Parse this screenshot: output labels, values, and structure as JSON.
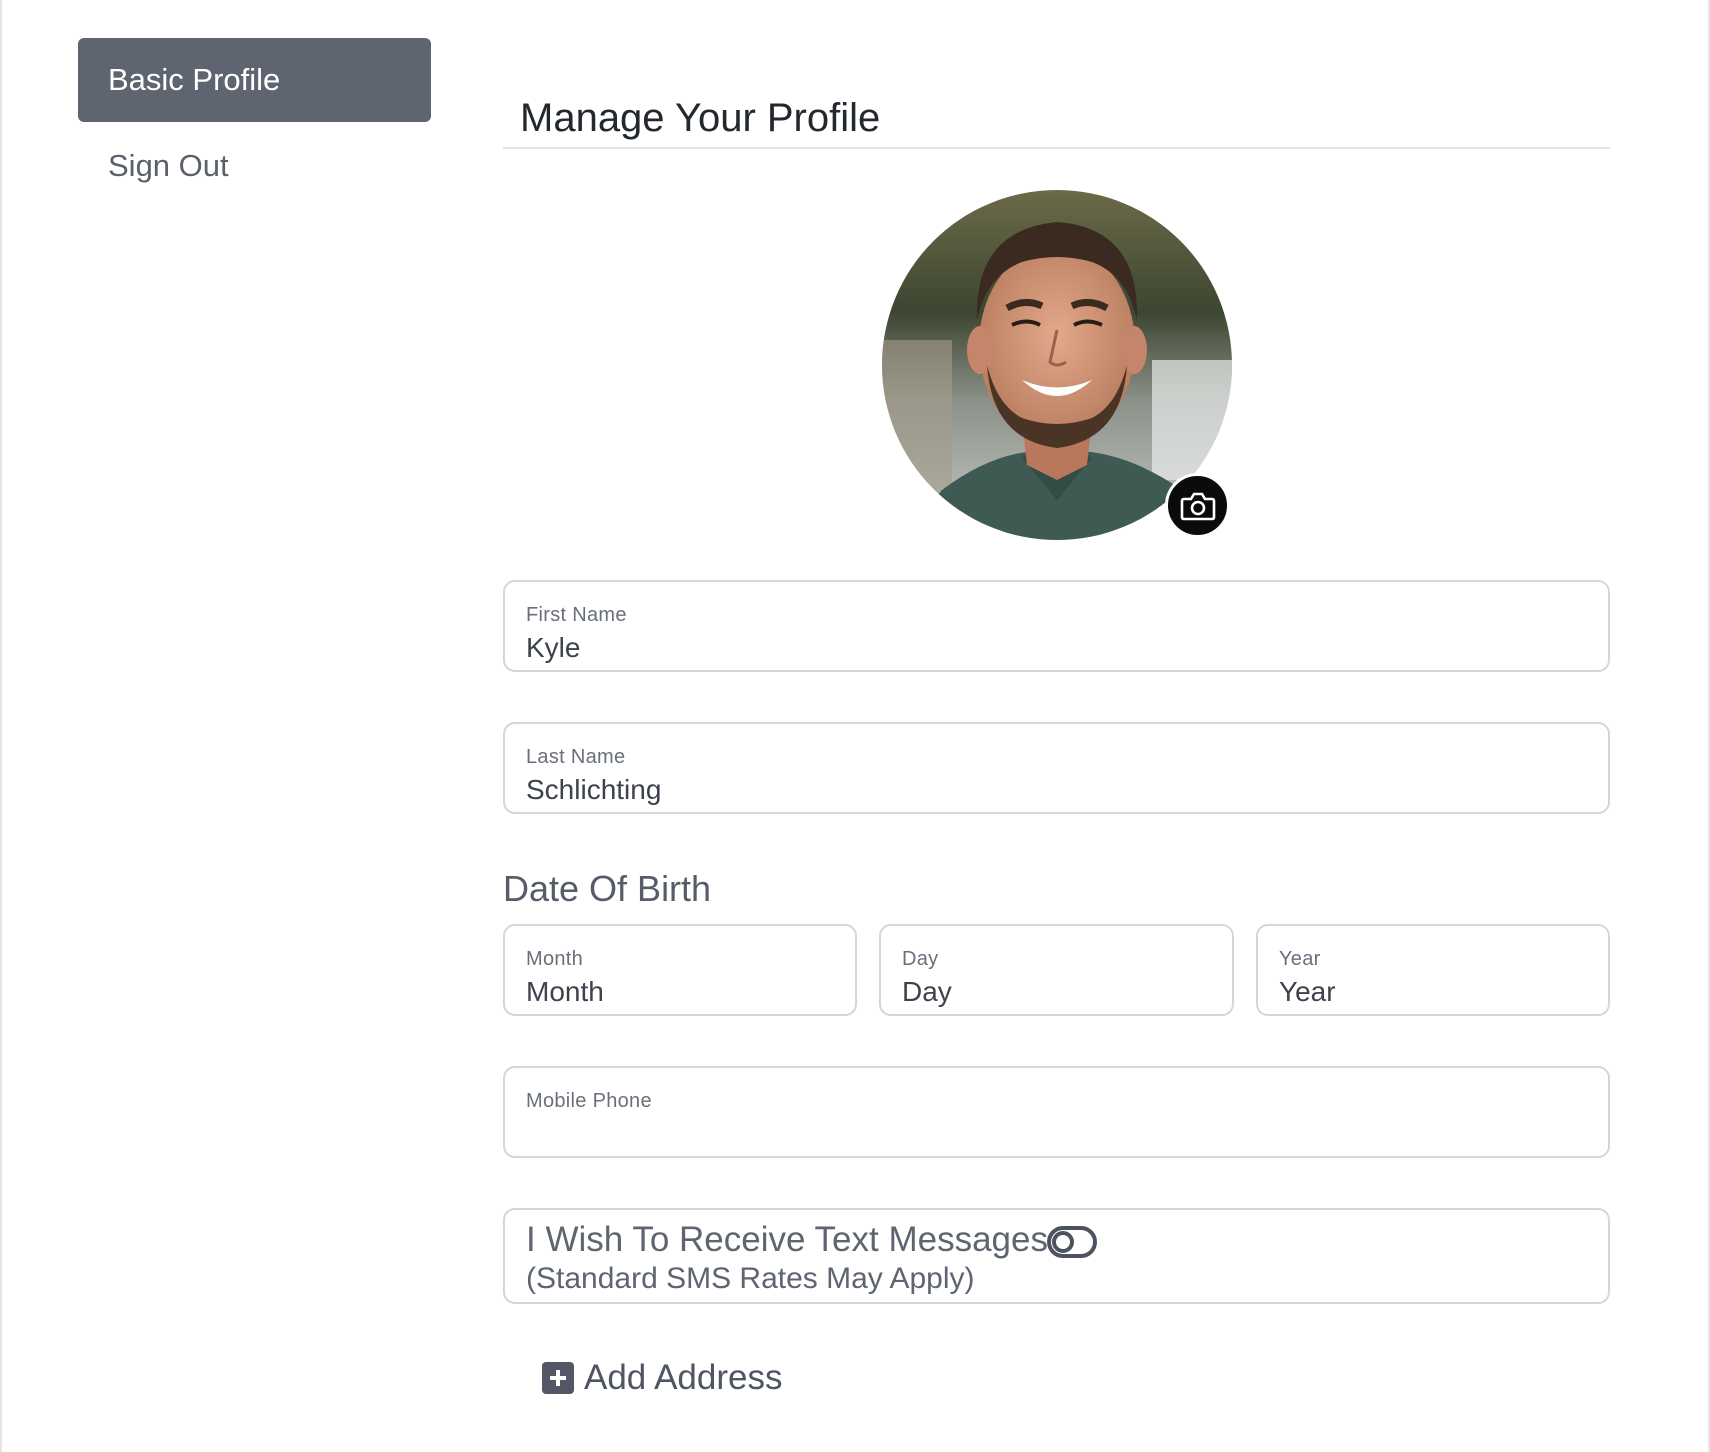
{
  "sidebar": {
    "items": [
      {
        "label": "Basic Profile",
        "active": true
      },
      {
        "label": "Sign Out",
        "active": false
      }
    ]
  },
  "main": {
    "title": "Manage Your Profile",
    "avatar": {
      "camera_icon": "camera-icon"
    },
    "fields": {
      "first_name": {
        "label": "First Name",
        "value": "Kyle"
      },
      "last_name": {
        "label": "Last Name",
        "value": "Schlichting"
      },
      "mobile_phone": {
        "label": "Mobile Phone",
        "value": ""
      }
    },
    "dob": {
      "heading": "Date Of Birth",
      "month": {
        "label": "Month",
        "value": "Month"
      },
      "day": {
        "label": "Day",
        "value": "Day"
      },
      "year": {
        "label": "Year",
        "value": "Year"
      }
    },
    "sms": {
      "line1": "I Wish To Receive Text Messages",
      "line2": "(Standard SMS Rates May Apply)",
      "enabled": false
    },
    "add_address": {
      "label": "Add Address",
      "icon": "plus-square-icon"
    }
  },
  "colors": {
    "nav_active_bg": "#5f6570",
    "field_border": "#d4d6da",
    "camera_button": "#0b0b0b"
  }
}
